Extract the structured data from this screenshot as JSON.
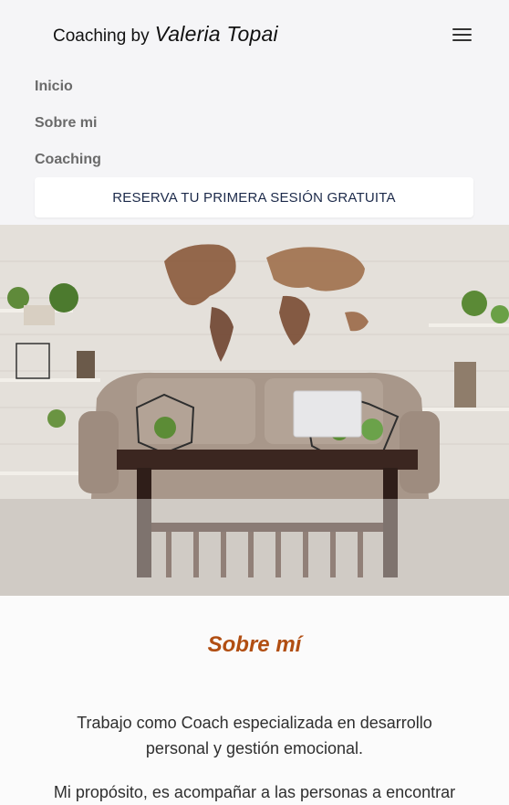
{
  "brand": {
    "prefix": "Coaching by",
    "name": "Valeria Topai"
  },
  "nav": {
    "items": [
      {
        "label": "Inicio"
      },
      {
        "label": "Sobre mi"
      },
      {
        "label": "Coaching"
      }
    ],
    "cta_label": "RESERVA TU PRIMERA SESIÓN GRATUITA",
    "menu_icon": "hamburger-menu-icon"
  },
  "hero": {
    "description": "living room photo"
  },
  "about": {
    "title": "Sobre mí",
    "paragraph1": "Trabajo como Coach especializada en desarrollo personal y gestión emocional.",
    "paragraph2": "Mi propósito, es acompañar a las personas a encontrar"
  },
  "colors": {
    "accent": "#b14e12",
    "cta_text": "#1c2a4a",
    "nav_text": "#6a6a6a"
  }
}
